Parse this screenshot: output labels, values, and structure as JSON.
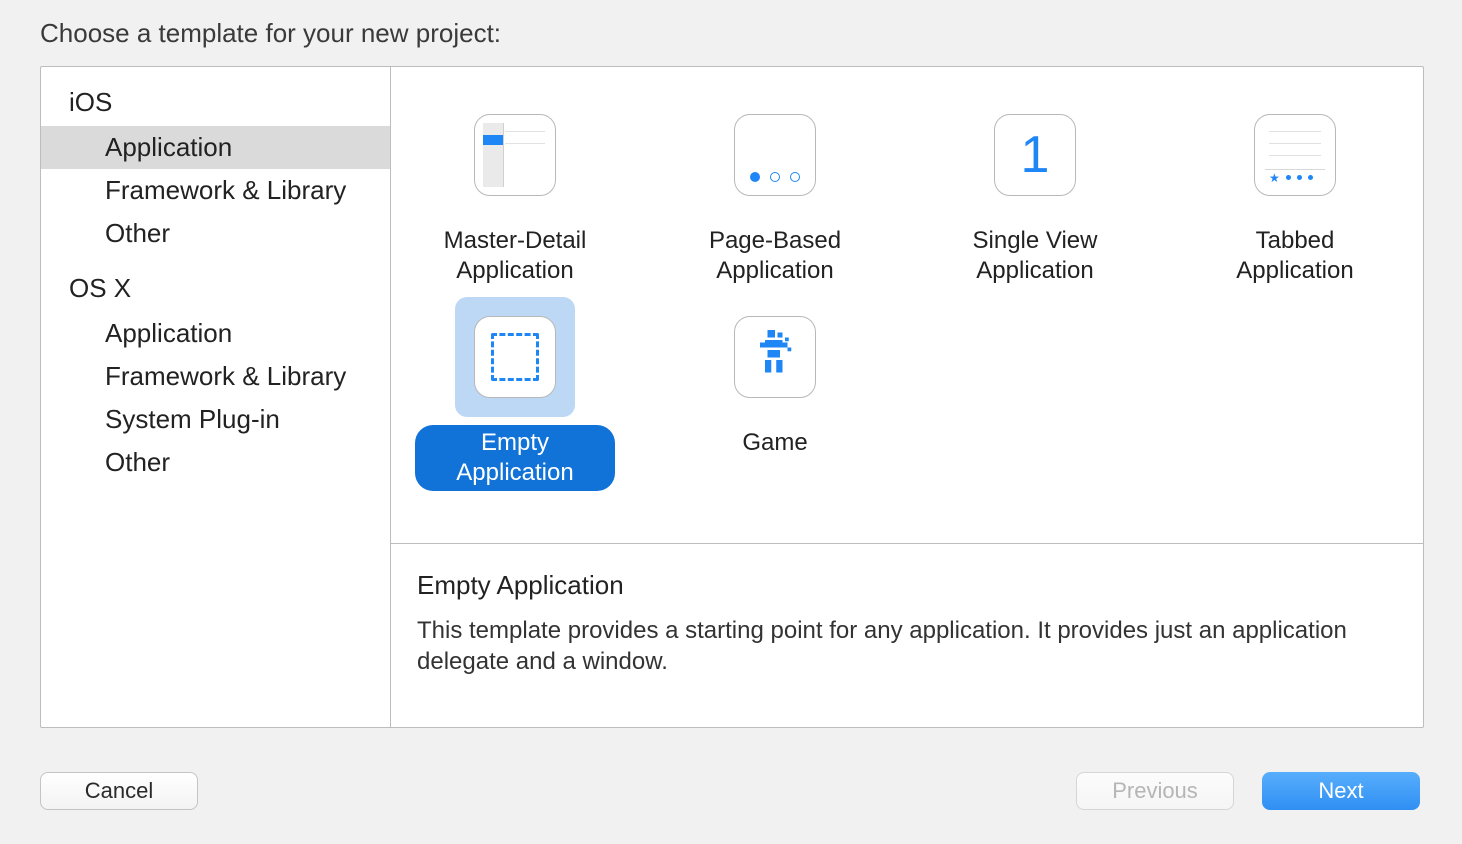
{
  "prompt": "Choose a template for your new project:",
  "sidebar": {
    "groups": [
      {
        "header": "iOS",
        "items": [
          {
            "label": "Application",
            "selected": true
          },
          {
            "label": "Framework & Library",
            "selected": false
          },
          {
            "label": "Other",
            "selected": false
          }
        ]
      },
      {
        "header": "OS X",
        "items": [
          {
            "label": "Application",
            "selected": false
          },
          {
            "label": "Framework & Library",
            "selected": false
          },
          {
            "label": "System Plug-in",
            "selected": false
          },
          {
            "label": "Other",
            "selected": false
          }
        ]
      }
    ]
  },
  "templates": [
    {
      "icon": "master-detail",
      "label": "Master-Detail Application",
      "selected": false
    },
    {
      "icon": "page-based",
      "label": "Page-Based Application",
      "selected": false
    },
    {
      "icon": "single-view",
      "label": "Single View Application",
      "selected": false
    },
    {
      "icon": "tabbed",
      "label": "Tabbed Application",
      "selected": false
    },
    {
      "icon": "empty",
      "label": "Empty Application",
      "selected": true
    },
    {
      "icon": "game",
      "label": "Game",
      "selected": false
    }
  ],
  "description": {
    "title": "Empty Application",
    "body": "This template provides a starting point for any application. It provides just an application delegate and a window."
  },
  "buttons": {
    "cancel": "Cancel",
    "previous": "Previous",
    "next": "Next"
  },
  "colors": {
    "accent": "#1f86f6",
    "selection_bg": "#bcd8f5",
    "selection_label_bg": "#1173d8"
  }
}
